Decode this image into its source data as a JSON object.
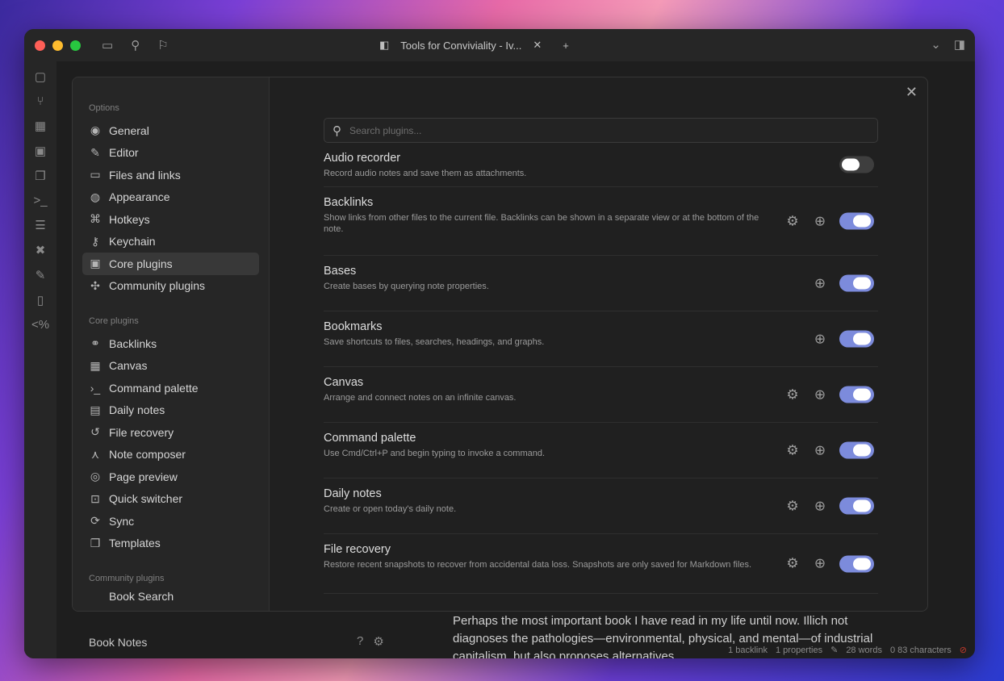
{
  "window": {
    "tab_title": "Tools for Conviviality - Iv...",
    "vault_name": "Book Notes",
    "note_text": "Perhaps the most important book I have read in my life until now. Illich not diagnoses the pathologies—environmental, physical, and mental—of industrial capitalism, but also proposes alternatives",
    "status": [
      "1 backlink",
      "1 properties",
      "28 words",
      "0 83 characters"
    ]
  },
  "colors": {
    "toggle_on": "#7c8bdc",
    "toggle_off": "#3e3e3e",
    "close_dot": "#fe5f57",
    "min_dot": "#febc2e",
    "max_dot": "#28c840"
  },
  "settings": {
    "sections": {
      "options": "Options",
      "core": "Core plugins",
      "community": "Community plugins"
    },
    "options_items": [
      {
        "label": "General",
        "icon": "user-circle-icon"
      },
      {
        "label": "Editor",
        "icon": "pencil-icon"
      },
      {
        "label": "Files and links",
        "icon": "folder-link-icon"
      },
      {
        "label": "Appearance",
        "icon": "palette-icon"
      },
      {
        "label": "Hotkeys",
        "icon": "command-icon"
      },
      {
        "label": "Keychain",
        "icon": "key-icon"
      },
      {
        "label": "Core plugins",
        "icon": "box-icon",
        "active": true
      },
      {
        "label": "Community plugins",
        "icon": "puzzle-icon"
      }
    ],
    "core_items": [
      {
        "label": "Backlinks",
        "icon": "link-icon"
      },
      {
        "label": "Canvas",
        "icon": "grid-icon"
      },
      {
        "label": "Command palette",
        "icon": "terminal-icon"
      },
      {
        "label": "Daily notes",
        "icon": "calendar-icon"
      },
      {
        "label": "File recovery",
        "icon": "history-icon"
      },
      {
        "label": "Note composer",
        "icon": "merge-icon"
      },
      {
        "label": "Page preview",
        "icon": "preview-icon"
      },
      {
        "label": "Quick switcher",
        "icon": "switch-icon"
      },
      {
        "label": "Sync",
        "icon": "sync-icon"
      },
      {
        "label": "Templates",
        "icon": "template-icon"
      }
    ],
    "community_peek": "Book Search",
    "search_placeholder": "Search plugins...",
    "plugins": [
      {
        "name": "Audio recorder",
        "desc": "Record audio notes and save them as attachments.",
        "gear": false,
        "plus": false,
        "enabled": false
      },
      {
        "name": "Backlinks",
        "desc": "Show links from other files to the current file. Backlinks can be shown in a separate view or at the bottom of the note.",
        "gear": true,
        "plus": true,
        "enabled": true
      },
      {
        "name": "Bases",
        "desc": "Create bases by querying note properties.",
        "gear": false,
        "plus": true,
        "enabled": true
      },
      {
        "name": "Bookmarks",
        "desc": "Save shortcuts to files, searches, headings, and graphs.",
        "gear": false,
        "plus": true,
        "enabled": true
      },
      {
        "name": "Canvas",
        "desc": "Arrange and connect notes on an infinite canvas.",
        "gear": true,
        "plus": true,
        "enabled": true
      },
      {
        "name": "Command palette",
        "desc": "Use Cmd/Ctrl+P and begin typing to invoke a command.",
        "gear": true,
        "plus": true,
        "enabled": true
      },
      {
        "name": "Daily notes",
        "desc": "Create or open today's daily note.",
        "gear": true,
        "plus": true,
        "enabled": true
      },
      {
        "name": "File recovery",
        "desc": "Restore recent snapshots to recover from accidental data loss. Snapshots are only saved for Markdown files.",
        "gear": true,
        "plus": true,
        "enabled": true
      }
    ]
  }
}
